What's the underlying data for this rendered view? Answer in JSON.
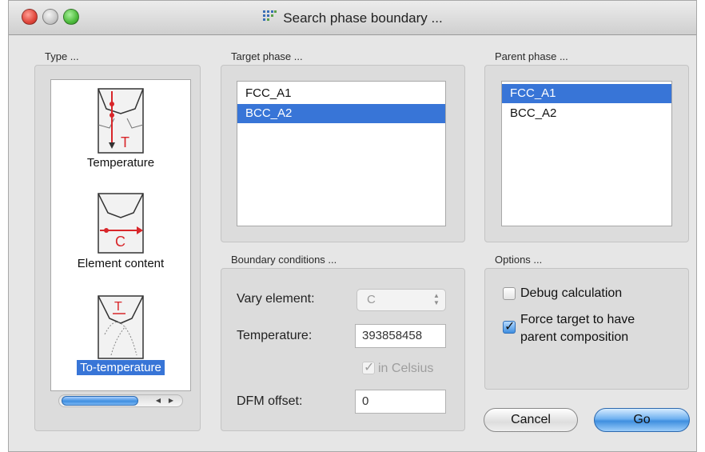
{
  "window": {
    "title": "Search  phase boundary ..."
  },
  "type_group": {
    "label": "Type ...",
    "items": [
      {
        "label": "Temperature",
        "icon": "temperature-diagram-icon",
        "selected": false
      },
      {
        "label": "Element content",
        "icon": "element-content-diagram-icon",
        "selected": false
      },
      {
        "label": "To-temperature",
        "icon": "to-temperature-diagram-icon",
        "selected": true
      }
    ],
    "icon_letters": [
      "T",
      "C",
      "T"
    ]
  },
  "target_phase": {
    "label": "Target phase ...",
    "items": [
      "FCC_A1",
      "BCC_A2"
    ],
    "selected": "BCC_A2"
  },
  "parent_phase": {
    "label": "Parent phase ...",
    "items": [
      "FCC_A1",
      "BCC_A2"
    ],
    "selected": "FCC_A1"
  },
  "boundary_conditions": {
    "label": "Boundary conditions ...",
    "vary_element_label": "Vary element:",
    "vary_element_value": "C",
    "temperature_label": "Temperature:",
    "temperature_value": "393858458",
    "in_celsius_label": "in Celsius",
    "in_celsius_checked": true,
    "dfm_offset_label": "DFM offset:",
    "dfm_offset_value": "0"
  },
  "options": {
    "label": "Options ...",
    "debug_label": "Debug calculation",
    "debug_checked": false,
    "force_label_line1": "Force target to have",
    "force_label_line2": "parent composition",
    "force_checked": true
  },
  "buttons": {
    "cancel": "Cancel",
    "go": "Go"
  },
  "colors": {
    "selection": "#3875d7",
    "diagram_red": "#d8262a"
  }
}
